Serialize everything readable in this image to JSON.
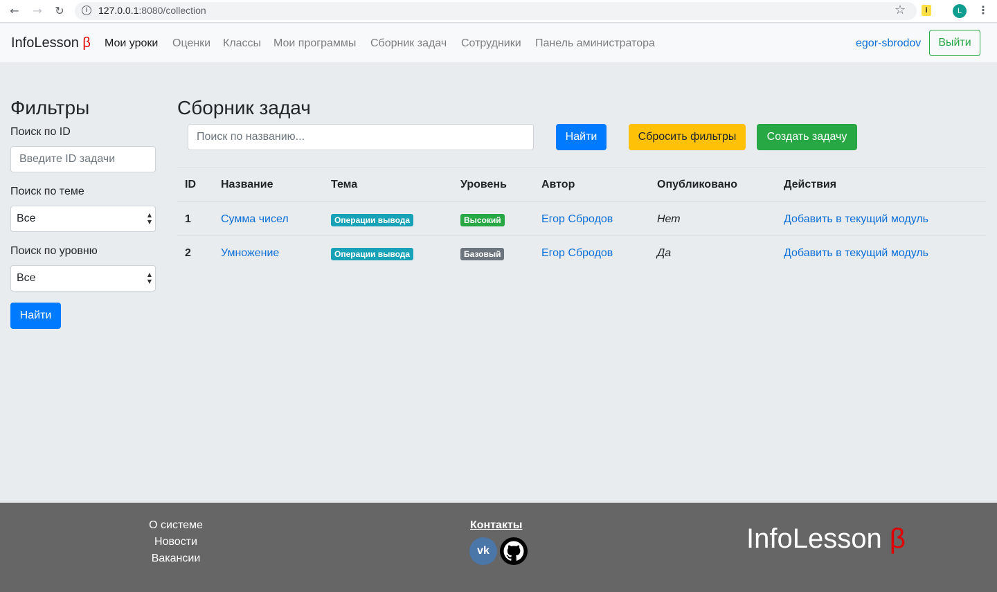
{
  "browser": {
    "url_host": "127.0.0.1",
    "url_rest": ":8080/collection",
    "profile_initial": "L",
    "ext_label": "i"
  },
  "navbar": {
    "brand": "InfoLesson",
    "beta": "β",
    "links": [
      "Мои уроки",
      "Оценки",
      "Классы",
      "Мои программы",
      "Сборник задач",
      "Сотрудники",
      "Панель аминистратора"
    ],
    "user": "egor-sbrodov",
    "logout": "Выйти"
  },
  "filters": {
    "title": "Фильтры",
    "id_label": "Поиск по ID",
    "id_placeholder": "Введите ID задачи",
    "theme_label": "Поиск по теме",
    "theme_value": "Все",
    "level_label": "Поиск по уровню",
    "level_value": "Все",
    "find": "Найти"
  },
  "main": {
    "title": "Сборник задач",
    "search_placeholder": "Поиск по названию...",
    "find": "Найти",
    "reset": "Сбросить фильтры",
    "create": "Создать задачу"
  },
  "table": {
    "headers": [
      "ID",
      "Название",
      "Тема",
      "Уровень",
      "Автор",
      "Опубликовано",
      "Действия"
    ],
    "rows": [
      {
        "id": "1",
        "name": "Сумма чисел",
        "theme": "Операции вывода",
        "level": "Высокий",
        "level_color": "#28a745",
        "author": "Егор Сбродов",
        "published": "Нет",
        "action": "Добавить в текущий модуль"
      },
      {
        "id": "2",
        "name": "Умножение",
        "theme": "Операции вывода",
        "level": "Базовый",
        "level_color": "#6c757d",
        "author": "Егор Сбродов",
        "published": "Да",
        "action": "Добавить в текущий модуль"
      }
    ]
  },
  "footer": {
    "links": [
      "О системе",
      "Новости",
      "Вакансии"
    ],
    "contacts": "Контакты",
    "vk": "vk-icon",
    "github": "github-icon",
    "brand": "InfoLesson",
    "beta": "β"
  },
  "colors": {
    "primary": "#007bff",
    "warning": "#ffc107",
    "success": "#28a745",
    "info": "#17a2b8",
    "secondary": "#6c757d",
    "footer_bg": "#666666",
    "beta": "#e00000"
  }
}
